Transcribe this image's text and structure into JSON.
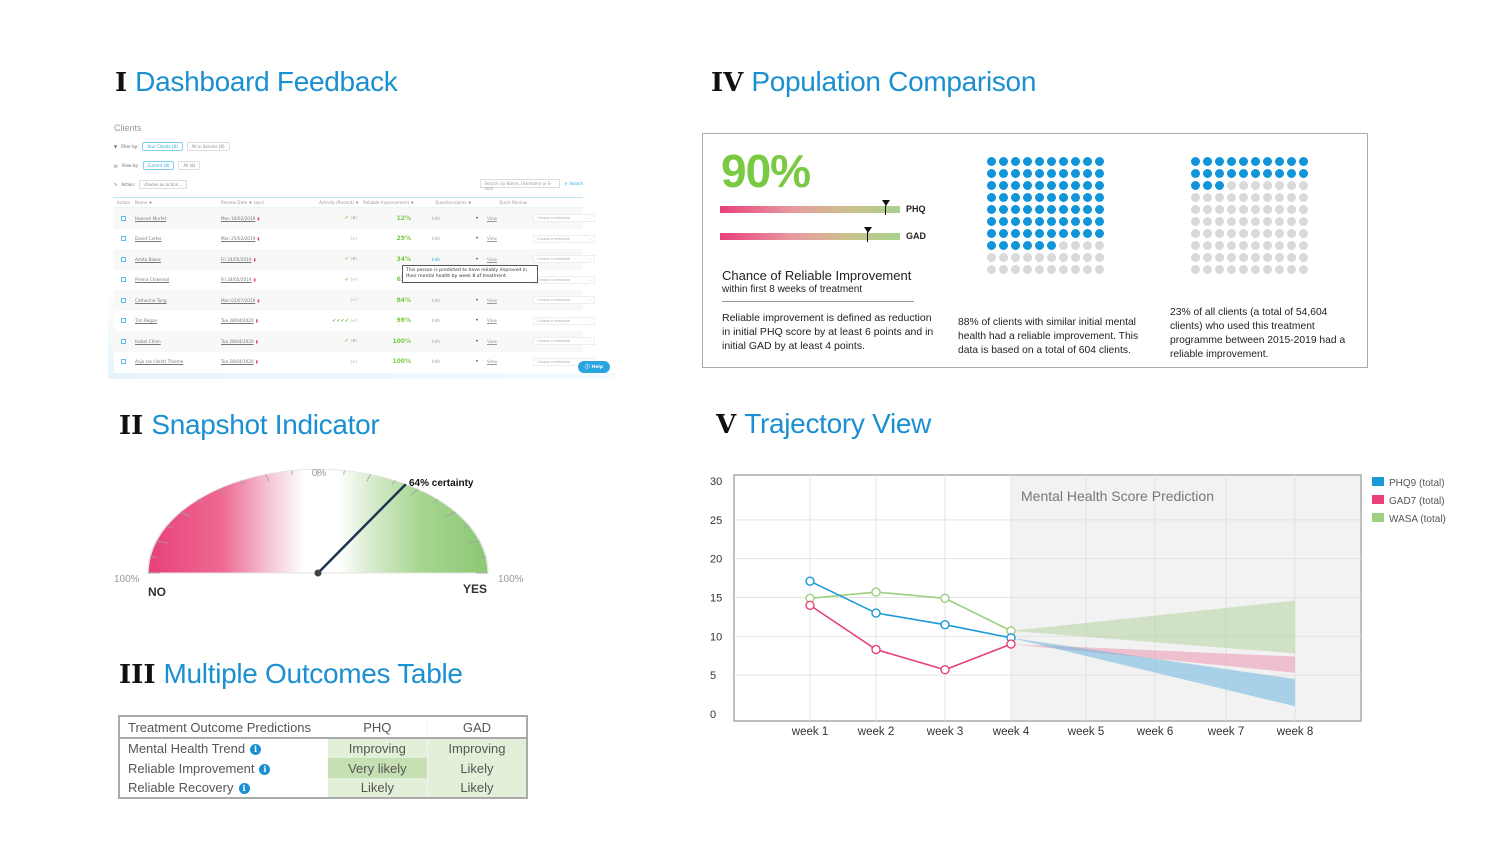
{
  "sections": {
    "s1": {
      "num": "I",
      "title": "Dashboard Feedback"
    },
    "s2": {
      "num": "II",
      "title": "Snapshot Indicator"
    },
    "s3": {
      "num": "III",
      "title": "Multiple Outcomes Table"
    },
    "s4": {
      "num": "IV",
      "title": "Population Comparison"
    },
    "s5": {
      "num": "V",
      "title": "Trajectory View"
    }
  },
  "dashboard": {
    "title": "Clients",
    "filter_label": "Filter by:",
    "filter_options": [
      "Your Clients (8)",
      "All in Service (8)"
    ],
    "view_label": "View by:",
    "view_options": [
      "Current (8)",
      "All (8)"
    ],
    "action_label": "Action:",
    "action_placeholder": "choose an action",
    "search_placeholder": "Search via Name, Username or E-mail",
    "search_button": "Search",
    "columns": [
      "Action",
      "Name ♦",
      "Review Date ♦ (asc)",
      "Activity (Recent) ♦",
      "Reliable Improvement ♦",
      "",
      "Questionnaires ♦",
      "",
      "Quick Review",
      ""
    ],
    "rows": [
      {
        "name": "Hannah Murfet",
        "date": "Mon 18/02/2019",
        "activity": "✔",
        "activity_extra": "(✖)",
        "pct": "12%",
        "info": "Info",
        "view": "View",
        "template": "Choose a template"
      },
      {
        "name": "David Carter",
        "date": "Mon 25/02/2019",
        "activity": "",
        "activity_extra": "(✔)",
        "pct": "29%",
        "info": "Info",
        "view": "View",
        "template": "Choose a template"
      },
      {
        "name": "Amita Biwas",
        "date": "Fri 24/05/2019",
        "activity": "✔",
        "activity_extra": "(✖)",
        "pct": "34%",
        "info": "Info",
        "view": "View",
        "template": "Choose a template"
      },
      {
        "name": "Prerna Chikersal",
        "date": "Fri 24/05/2019",
        "activity": "✔",
        "activity_extra": "(✔)",
        "pct": "63%",
        "info": "Info",
        "view": "View",
        "template": "Choose a template"
      },
      {
        "name": "Catherine Tong",
        "date": "Mon 01/07/2019",
        "activity": "",
        "activity_extra": "(✔)",
        "pct": "84%",
        "info": "Info",
        "view": "View",
        "template": "Choose a template"
      },
      {
        "name": "Tim Regan",
        "date": "Tue 28/04/2020",
        "activity": "✔✔✔✔",
        "activity_extra": "(✔)",
        "pct": "98%",
        "info": "Info",
        "view": "View",
        "template": "Choose a template"
      },
      {
        "name": "Isabel Chien",
        "date": "Tue 28/04/2020",
        "activity": "✔",
        "activity_extra": "(✖)",
        "pct": "100%",
        "info": "Info",
        "view": "View",
        "template": "Choose a template"
      },
      {
        "name": "Anja (as client) Thieme",
        "date": "Tue 28/04/2020",
        "activity": "",
        "activity_extra": "(✔)",
        "pct": "100%",
        "info": "Info",
        "view": "View",
        "template": "Choose a template"
      }
    ],
    "tooltip": "This person is predicted to have reliably improved in their mental health by week 8 of treatment.",
    "help_button": "Help"
  },
  "gauge": {
    "center_label": "0%",
    "left_label": "100%",
    "right_label": "100%",
    "no_label": "NO",
    "yes_label": "YES",
    "certainty_label": "64% certainty",
    "value_percent": 64,
    "direction": "YES",
    "colors": {
      "no": "#e8407a",
      "yes": "#8cc874"
    }
  },
  "outcomes_table": {
    "header": [
      "Treatment Outcome Predictions",
      "PHQ",
      "GAD"
    ],
    "rows": [
      {
        "label": "Mental Health Trend",
        "phq": "Improving",
        "gad": "Improving",
        "phq_strong": false
      },
      {
        "label": "Reliable Improvement",
        "phq": "Very likely",
        "gad": "Likely",
        "phq_strong": true
      },
      {
        "label": "Reliable Recovery",
        "phq": "Likely",
        "gad": "Likely",
        "phq_strong": false
      }
    ]
  },
  "population": {
    "headline": "90%",
    "bars": [
      {
        "label": "PHQ",
        "value_percent": 92
      },
      {
        "label": "GAD",
        "value_percent": 82
      }
    ],
    "chance_title": "Chance of Reliable Improvement",
    "chance_sub": "within first 8 weeks of treatment",
    "definition": "Reliable improvement is defined as reduction in initial PHQ score by at least 6 points and in initial GAD by at least 4 points.",
    "similar": {
      "filled": 76,
      "total": 100,
      "caption": "88% of clients with similar initial mental health had a reliable improvement. This data is based on a total of 604 clients."
    },
    "all": {
      "filled": 23,
      "total": 100,
      "caption": "23% of all clients (a total of 54,604 clients) who used this treatment programme between 2015-2019 had a reliable improvement."
    },
    "colors": {
      "on": "#0f95d8",
      "off": "#d9d9d9"
    }
  },
  "chart_data": {
    "type": "line",
    "title": "Mental Health Score Prediction",
    "xlabel": "",
    "ylabel": "",
    "categories": [
      "week 1",
      "week 2",
      "week 3",
      "week 4",
      "week 5",
      "week 6",
      "week 7",
      "week 8"
    ],
    "ylim": [
      0,
      30
    ],
    "yticks": [
      0,
      5,
      10,
      15,
      20,
      25,
      30
    ],
    "grid": true,
    "legend": "top-right",
    "prediction_start": "week 4",
    "series": [
      {
        "name": "PHQ9 (total)",
        "color": "#1a9ad6",
        "values": [
          17.1,
          13,
          11.5,
          9.8
        ],
        "band_start": 9.8,
        "band_end_low": 1,
        "band_end_high": 4.5
      },
      {
        "name": "GAD7 (total)",
        "color": "#e8407a",
        "values": [
          14,
          8.3,
          5.7,
          9
        ],
        "band_start": 9,
        "band_end_low": 5.3,
        "band_end_high": 7.4
      },
      {
        "name": "WASA (total)",
        "color": "#9fcf80",
        "values": [
          14.9,
          15.7,
          14.9,
          10.7
        ],
        "band_start": 10.7,
        "band_end_low": 7.8,
        "band_end_high": 14.6
      }
    ]
  }
}
